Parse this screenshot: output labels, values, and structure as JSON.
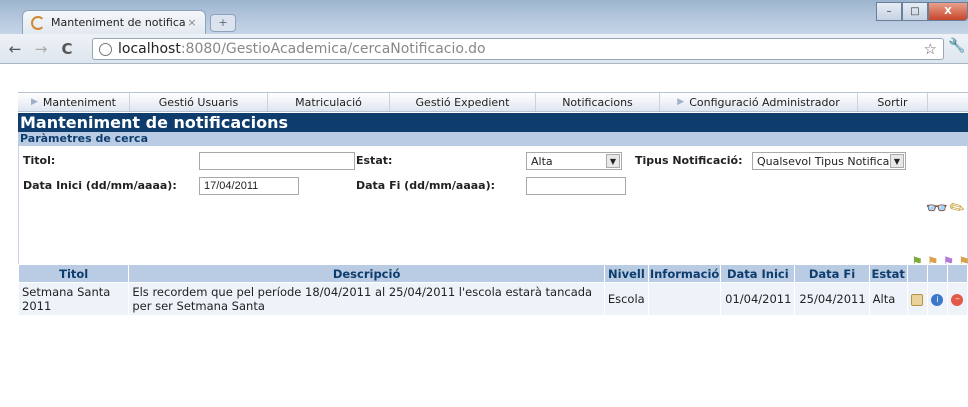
{
  "browser": {
    "tab_title": "Manteniment de notifica...",
    "tab_close": "×",
    "new_tab": "+",
    "back": "←",
    "forward": "→",
    "reload": "C",
    "url_host": "localhost",
    "url_rest": ":8080/GestioAcademica/cercaNotificacio.do",
    "star": "☆",
    "wrench": "🔧",
    "min": "–",
    "max": "□",
    "close": "X"
  },
  "menu": {
    "items": [
      {
        "label": "Manteniment",
        "arrow": true
      },
      {
        "label": "Gestió Usuaris",
        "arrow": false
      },
      {
        "label": "Matriculació",
        "arrow": false
      },
      {
        "label": "Gestió Expedient",
        "arrow": false
      },
      {
        "label": "Notificacions",
        "arrow": false
      },
      {
        "label": "Configuració Administrador",
        "arrow": true
      },
      {
        "label": "Sortir",
        "arrow": false
      }
    ]
  },
  "page": {
    "title": "Manteniment de notificacions",
    "params_title": "Paràmetres de cerca"
  },
  "search": {
    "titol_label": "Titol:",
    "titol_value": "",
    "estat_label": "Estat:",
    "estat_value": "Alta",
    "tipus_label": "Tipus Notificació:",
    "tipus_value": "Qualsevol Tipus Notifica",
    "data_inici_label": "Data Inici (dd/mm/aaaa):",
    "data_inici_value": "17/04/2011",
    "data_fi_label": "Data Fi (dd/mm/aaaa):",
    "data_fi_value": ""
  },
  "table": {
    "headers": [
      "Titol",
      "Descripció",
      "Nivell",
      "Informació",
      "Data Inici",
      "Data Fi",
      "Estat",
      "",
      "",
      ""
    ],
    "rows": [
      {
        "titol": "Setmana Santa 2011",
        "descripcio": "Els recordem que pel període 18/04/2011 al 25/04/2011 l'escola estarà tancada per ser Setmana Santa",
        "nivell": "Escola",
        "informacio": "",
        "data_inici": "01/04/2011",
        "data_fi": "25/04/2011",
        "estat": "Alta"
      }
    ]
  },
  "icons": {
    "info_glyph": "i",
    "delete_glyph": "–"
  }
}
